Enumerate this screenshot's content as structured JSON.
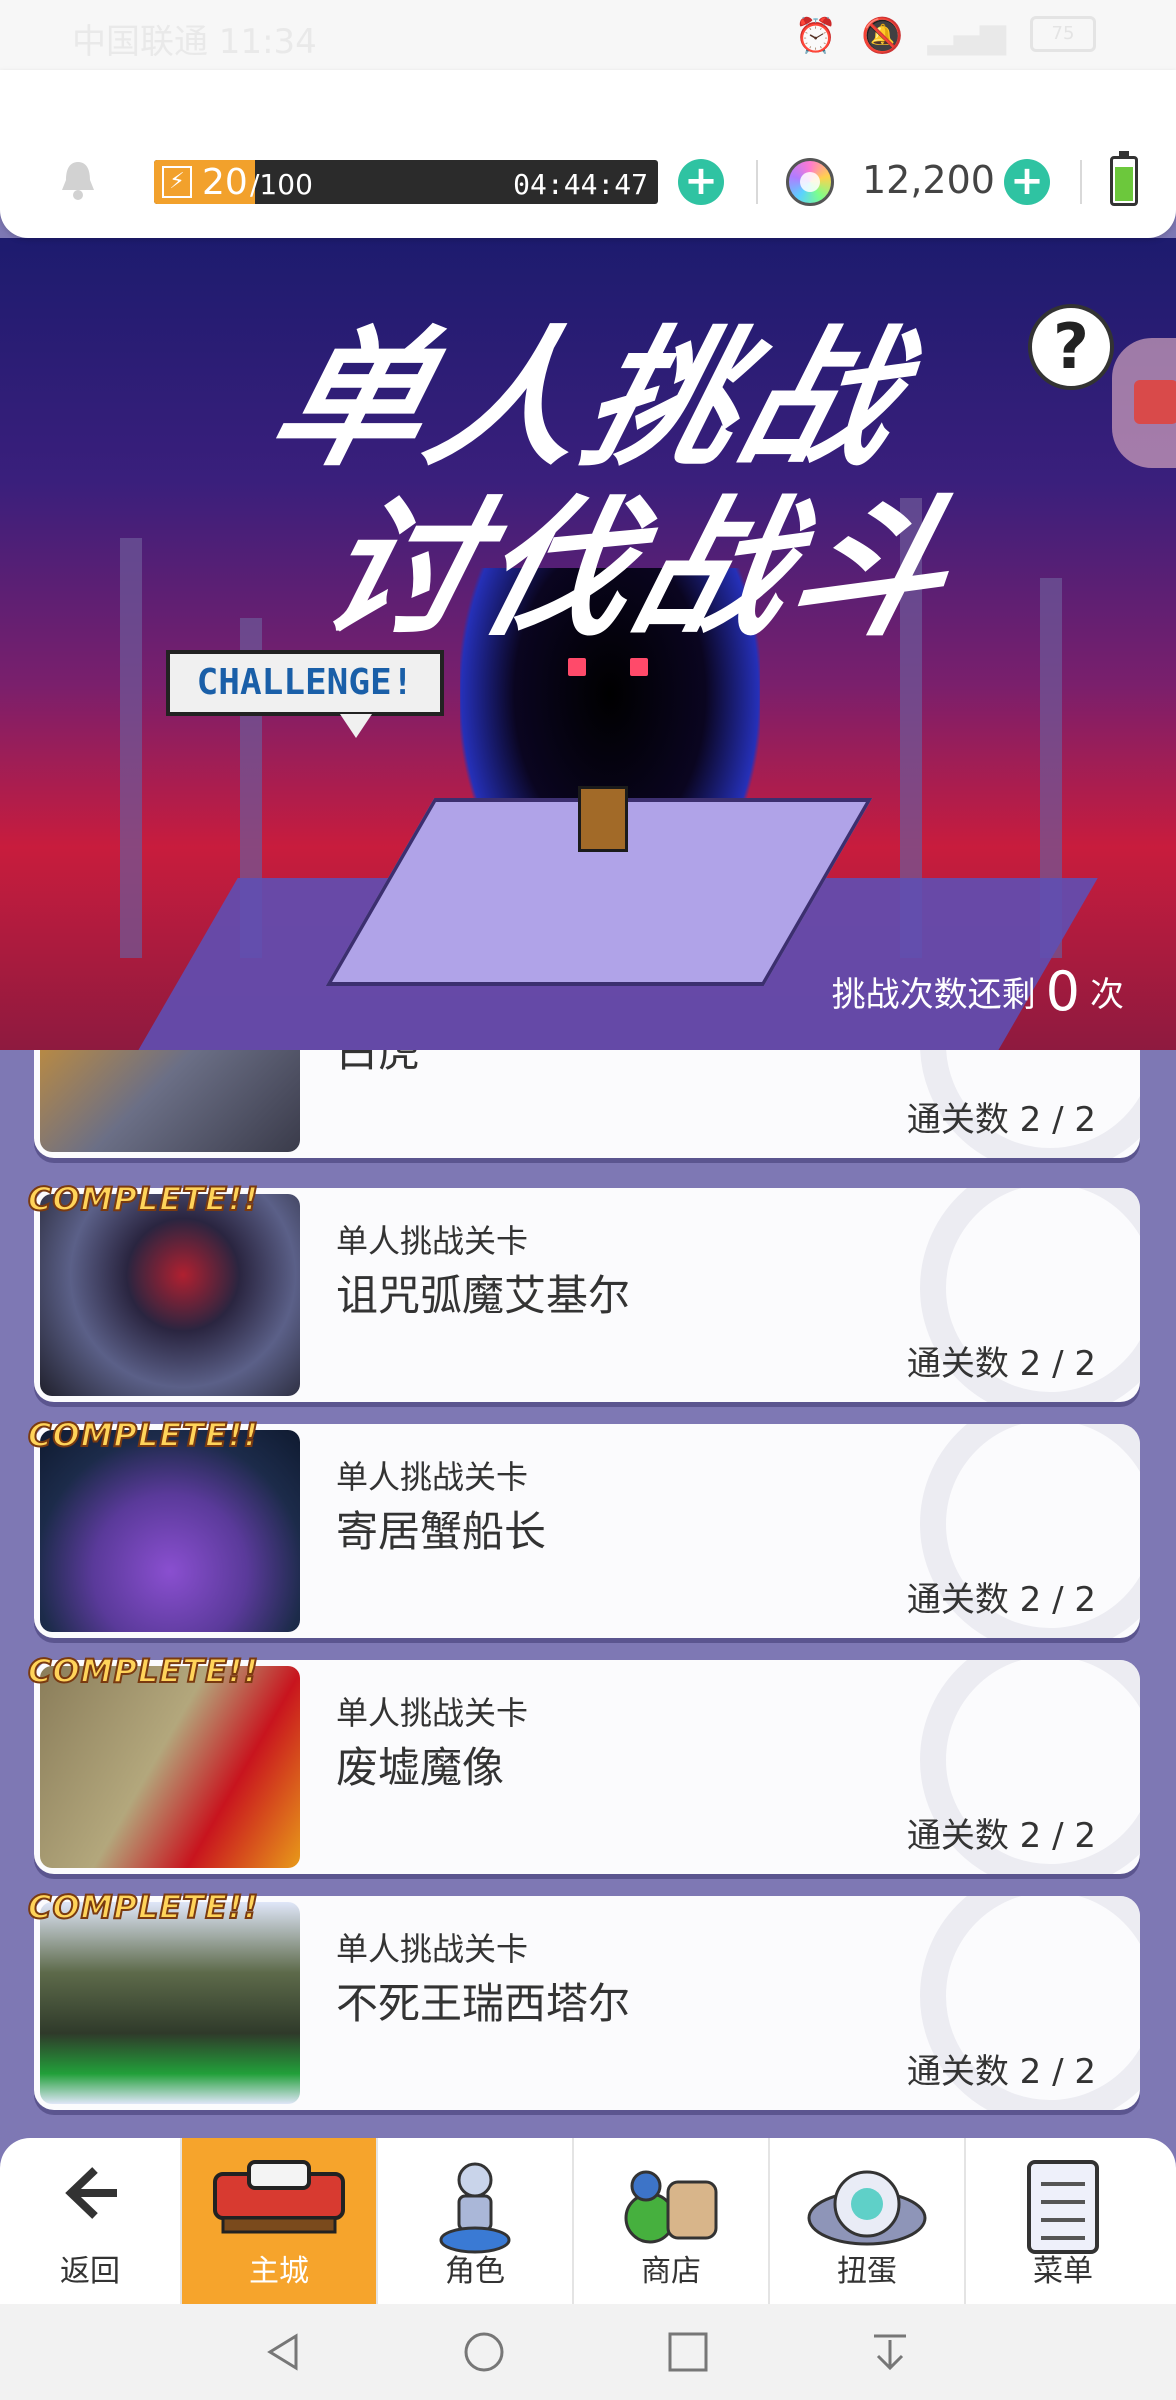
{
  "status_bar": {
    "carrier_time": "中国联通 11:34",
    "battery": "75"
  },
  "header": {
    "stamina_current": "20",
    "stamina_max": "/100",
    "stamina_fraction": 0.2,
    "stamina_timer": "04:44:47",
    "gem_count": "12,200"
  },
  "banner": {
    "title_line1": "单人挑战",
    "title_line2": "讨伐战斗",
    "bubble_text": "CHALLENGE!",
    "help_symbol": "?",
    "remaining_prefix": "挑战次数还剩",
    "remaining_count": "0",
    "remaining_suffix": "次"
  },
  "stages": [
    {
      "complete": "",
      "subtitle": "",
      "name": "白虎",
      "clear": "通关数 2 / 2"
    },
    {
      "complete": "COMPLETE!!",
      "subtitle": "单人挑战关卡",
      "name": "诅咒弧魔艾基尔",
      "clear": "通关数 2 / 2"
    },
    {
      "complete": "COMPLETE!!",
      "subtitle": "单人挑战关卡",
      "name": "寄居蟹船长",
      "clear": "通关数 2 / 2"
    },
    {
      "complete": "COMPLETE!!",
      "subtitle": "单人挑战关卡",
      "name": "废墟魔像",
      "clear": "通关数 2 / 2"
    },
    {
      "complete": "COMPLETE!!",
      "subtitle": "单人挑战关卡",
      "name": "不死王瑞西塔尔",
      "clear": "通关数 2 / 2"
    }
  ],
  "bottom_nav": [
    {
      "label": "返回",
      "icon": "back-arrow-icon"
    },
    {
      "label": "主城",
      "icon": "castle-icon",
      "active": true
    },
    {
      "label": "角色",
      "icon": "character-icon"
    },
    {
      "label": "商店",
      "icon": "shop-icon"
    },
    {
      "label": "扭蛋",
      "icon": "gacha-icon"
    },
    {
      "label": "菜单",
      "icon": "menu-icon"
    }
  ],
  "colors": {
    "accent": "#f6a42c",
    "plus": "#2fc3a2",
    "list_bg": "#7e78b4"
  }
}
